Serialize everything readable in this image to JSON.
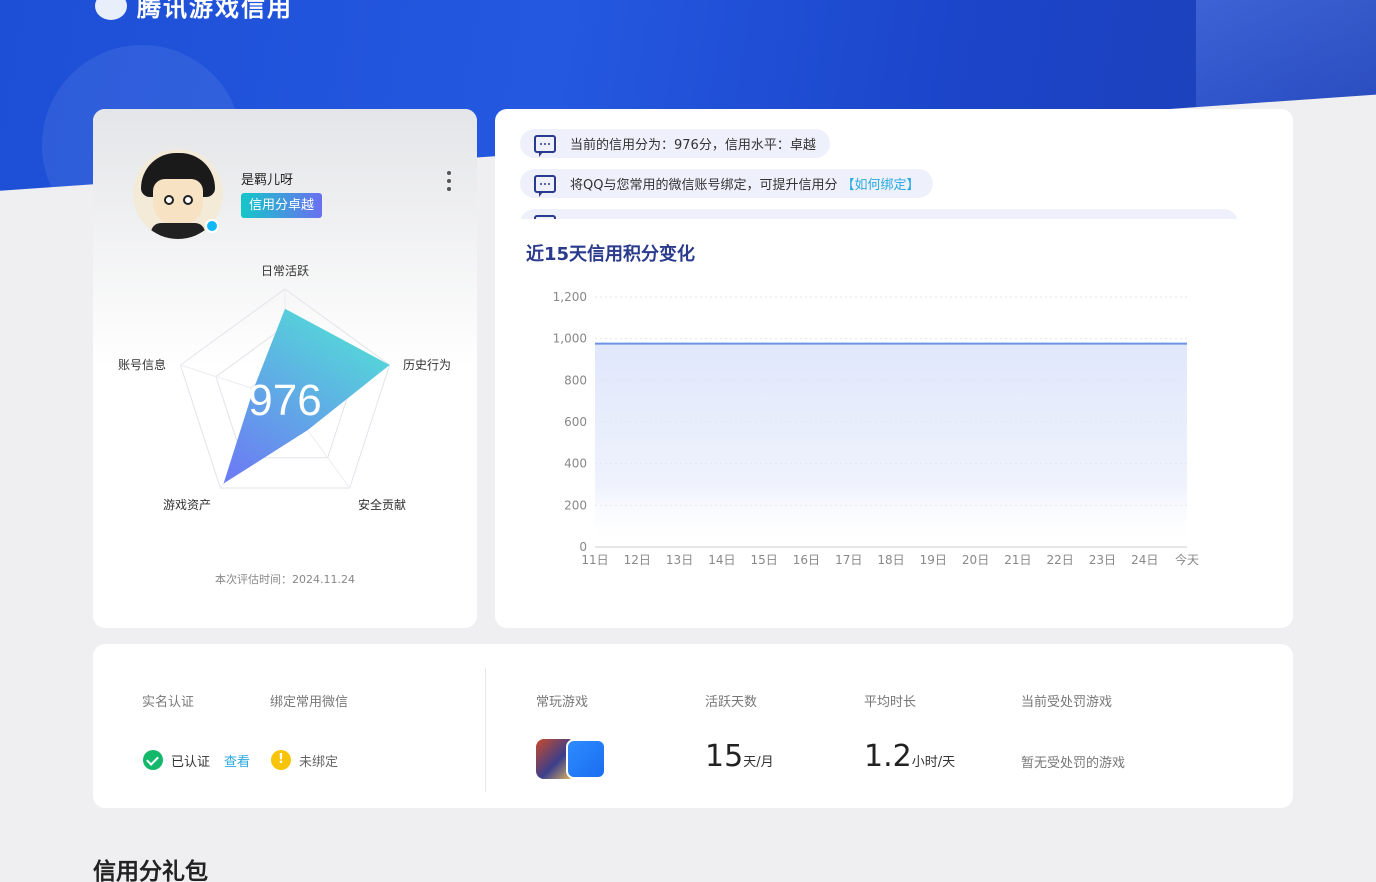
{
  "header": {
    "logo_text": "腾讯游戏信用"
  },
  "profile": {
    "nickname": "是羁儿呀",
    "level_badge": "信用分卓越",
    "score": "976",
    "eval_time": "本次评估时间：2024.11.24",
    "radar": {
      "axes": [
        "日常活跃",
        "历史行为",
        "安全贡献",
        "游戏资产",
        "账号信息"
      ],
      "values": [
        0.82,
        1.0,
        0.35,
        0.95,
        0.3
      ],
      "fill_start": "#52e0d6",
      "fill_end": "#6b7ff2"
    }
  },
  "notices": [
    {
      "text": "当前的信用分为：976分，信用水平：卓越",
      "link": ""
    },
    {
      "text": "将QQ与您常用的微信账号绑定，可提升信用分",
      "link": "【如何绑定】"
    }
  ],
  "chart": {
    "title": "近15天信用积分变化"
  },
  "chart_data": {
    "type": "area",
    "title": "近15天信用积分变化",
    "x": [
      "11日",
      "12日",
      "13日",
      "14日",
      "15日",
      "16日",
      "17日",
      "18日",
      "19日",
      "20日",
      "21日",
      "22日",
      "23日",
      "24日",
      "今天"
    ],
    "values": [
      976,
      976,
      976,
      976,
      976,
      976,
      976,
      976,
      976,
      976,
      976,
      976,
      976,
      976,
      976
    ],
    "yticks": [
      "0",
      "200",
      "400",
      "600",
      "800",
      "1,000",
      "1,200"
    ],
    "ylim": [
      0,
      1200
    ],
    "grid": true,
    "line_color": "#6d92e8",
    "fill_color": "#dfe6fb"
  },
  "stats": {
    "realname_label": "实名认证",
    "wechat_label": "绑定常用微信",
    "realname_status": "已认证",
    "view_link": "查看",
    "wechat_status": "未绑定",
    "games_label": "常玩游戏",
    "active_days_label": "活跃天数",
    "active_days_value": "15",
    "active_days_unit": "天/月",
    "avg_time_label": "平均时长",
    "avg_time_value": "1.2",
    "avg_time_unit": "小时/天",
    "penalty_label": "当前受处罚游戏",
    "penalty_value": "暂无受处罚的游戏"
  },
  "gift_section": {
    "title": "信用分礼包"
  }
}
